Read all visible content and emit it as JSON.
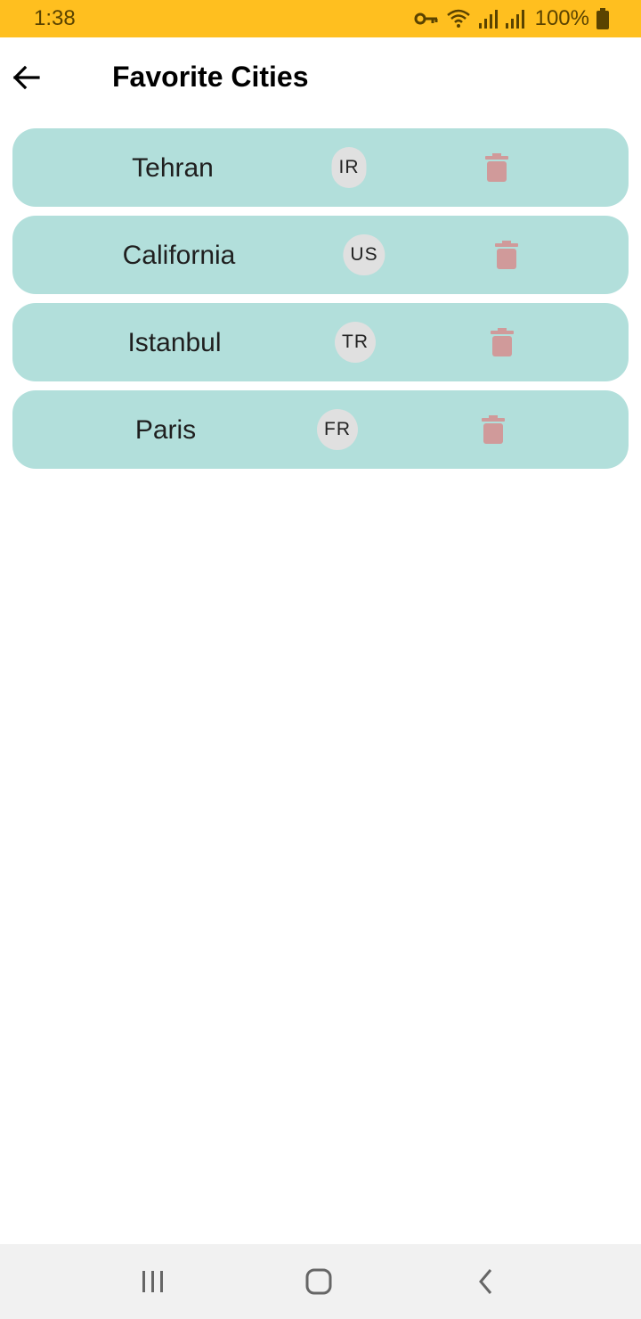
{
  "status_bar": {
    "time": "1:38",
    "battery_percent": "100%",
    "icons": [
      "key-icon",
      "wifi-icon",
      "signal-icon",
      "signal-icon",
      "battery-icon"
    ],
    "color": "#FFBF1F"
  },
  "app_bar": {
    "title": "Favorite Cities",
    "back_icon": "arrow-left-icon"
  },
  "cities": [
    {
      "name": "Tehran",
      "country": "IR"
    },
    {
      "name": "California",
      "country": "US"
    },
    {
      "name": "Istanbul",
      "country": "TR"
    },
    {
      "name": "Paris",
      "country": "FR"
    }
  ],
  "colors": {
    "card": "#B2DFDB",
    "chip": "#E0E0E0",
    "delete": "#D09A9A"
  },
  "nav_bar": {
    "icons": [
      "recent-apps-icon",
      "home-icon",
      "back-icon"
    ]
  }
}
